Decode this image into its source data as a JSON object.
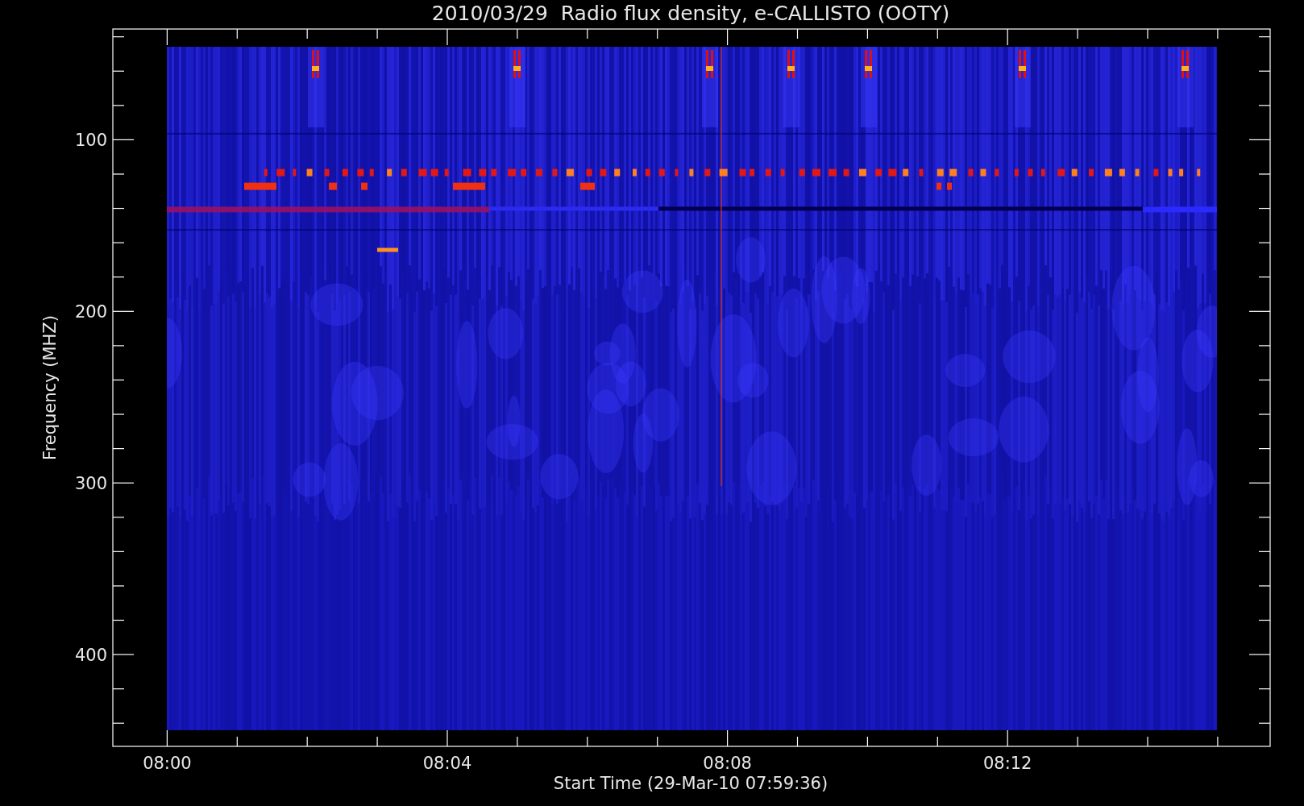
{
  "plot": {
    "title": "2010/03/29  Radio flux density, e-CALLISTO (OOTY)",
    "xlabel": "Start Time (29-Mar-10 07:59:36)",
    "ylabel": "Frequency (MHZ)",
    "x_tick_labels": [
      "08:00",
      "08:04",
      "08:08",
      "08:12"
    ],
    "y_tick_labels": [
      "100",
      "200",
      "300",
      "400"
    ]
  }
}
